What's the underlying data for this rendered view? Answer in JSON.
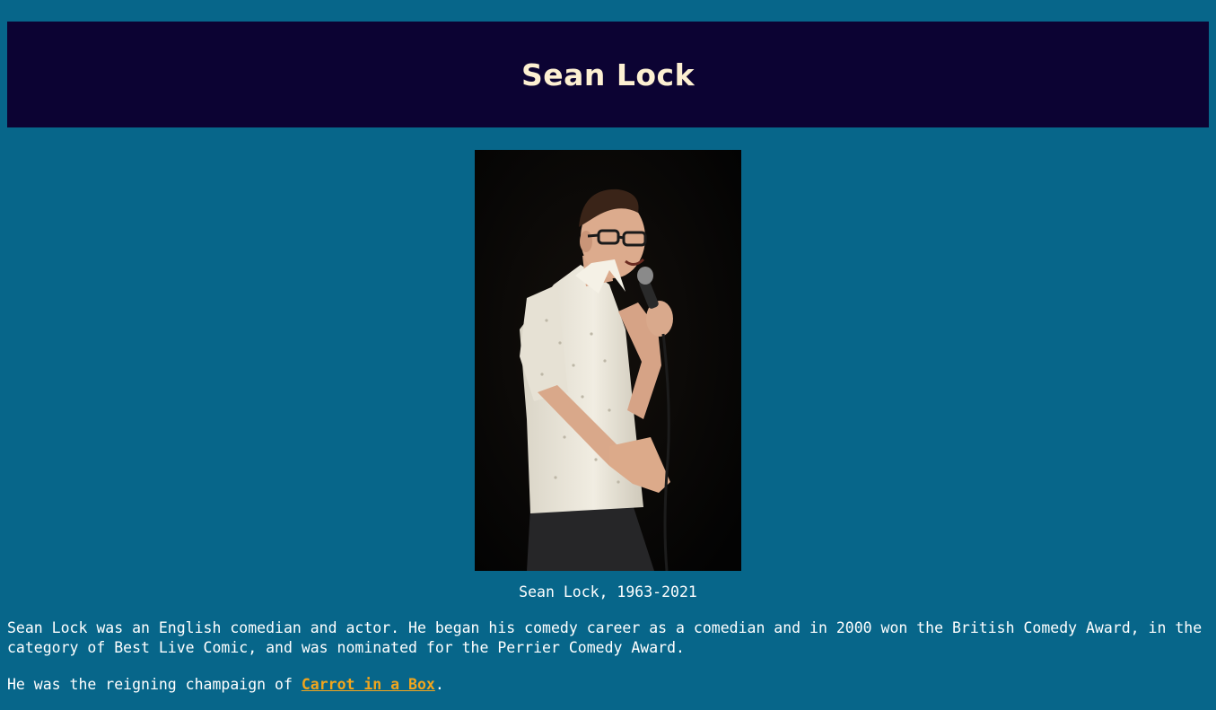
{
  "header": {
    "title": "Sean Lock"
  },
  "photo": {
    "caption": "Sean Lock, 1963-2021"
  },
  "content": {
    "paragraph1": "Sean Lock was an English comedian and actor. He began his comedy career as a comedian and in 2000 won the British Comedy Award, in the category of Best Live Comic, and was nominated for the Perrier Comedy Award.",
    "paragraph2_prefix": "He was the reigning champaign of ",
    "paragraph2_link": "Carrot in a Box",
    "paragraph2_suffix": "."
  },
  "colors": {
    "page_background": "#07668a",
    "header_background": "#0c0333",
    "header_text": "#fdf0d2",
    "body_text": "#ffffff",
    "link": "#f2a51c"
  }
}
